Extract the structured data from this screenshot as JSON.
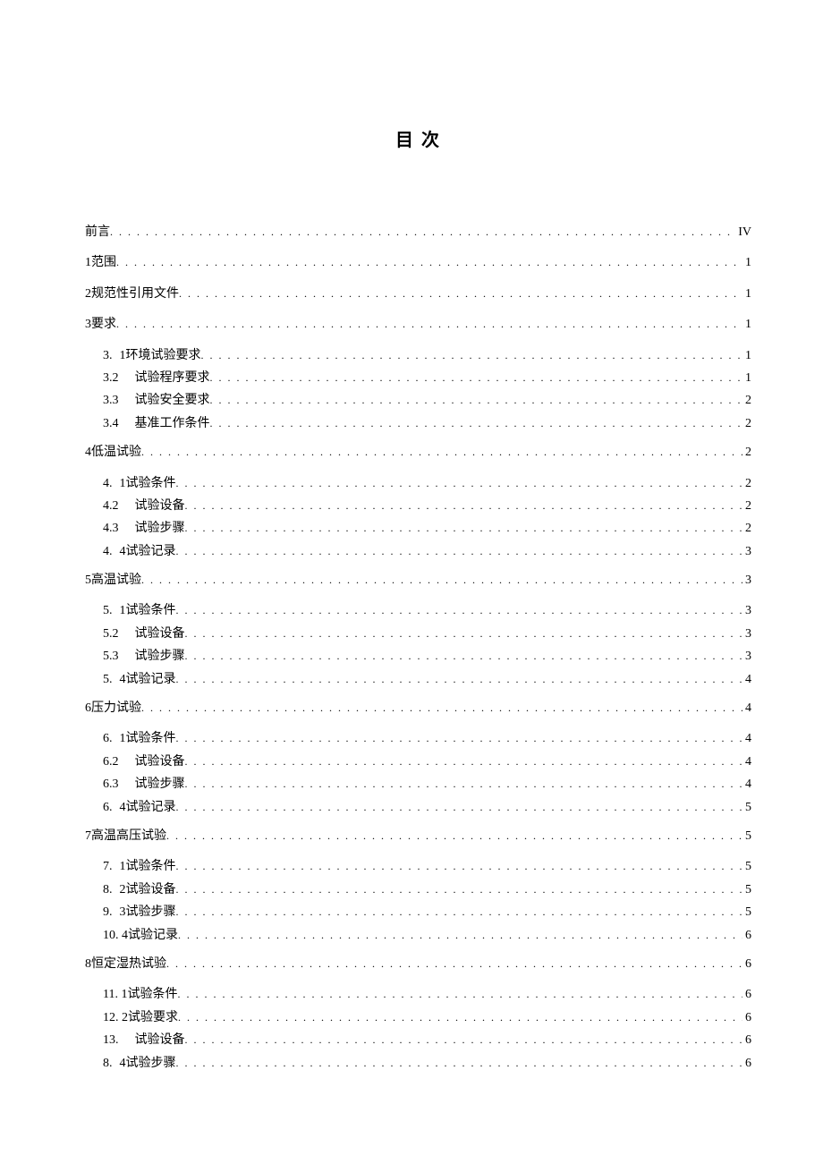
{
  "title": "目 次",
  "toc": [
    {
      "level": 1,
      "num": "",
      "label": "前言",
      "page": "IV"
    },
    {
      "level": 1,
      "num": "1",
      "label": "范围",
      "page": "1"
    },
    {
      "level": 1,
      "num": "2",
      "label": "规范性引用文件",
      "page": "1"
    },
    {
      "level": 1,
      "num": "3",
      "label": "要求",
      "page": "1",
      "children": [
        {
          "num": "3.",
          "sub": "1",
          "label": "环境试验要求",
          "page": "1",
          "style": "split"
        },
        {
          "num": "3.2",
          "label": "试验程序要求",
          "page": "1",
          "style": "wide"
        },
        {
          "num": "3.3",
          "label": "试验安全要求",
          "page": "2",
          "style": "wide"
        },
        {
          "num": "3.4",
          "label": "基准工作条件",
          "page": "2",
          "style": "wide"
        }
      ]
    },
    {
      "level": 1,
      "num": "4",
      "label": "低温试验",
      "page": "2",
      "children": [
        {
          "num": "4.",
          "sub": "1",
          "label": "试验条件",
          "page": "2",
          "style": "split"
        },
        {
          "num": "4.2",
          "label": "试验设备",
          "page": "2",
          "style": "wide"
        },
        {
          "num": "4.3",
          "label": "试验步骤",
          "page": "2",
          "style": "wide"
        },
        {
          "num": "4.",
          "sub": "4",
          "label": "试验记录",
          "page": "3",
          "style": "split"
        }
      ]
    },
    {
      "level": 1,
      "num": "5",
      "label": "高温试验",
      "page": "3",
      "children": [
        {
          "num": "5.",
          "sub": "1",
          "label": "试验条件",
          "page": "3",
          "style": "split"
        },
        {
          "num": "5.2",
          "label": "试验设备",
          "page": "3",
          "style": "wide"
        },
        {
          "num": "5.3",
          "label": "试验步骤",
          "page": "3",
          "style": "wide"
        },
        {
          "num": "5.",
          "sub": "4",
          "label": "试验记录",
          "page": "4",
          "style": "split"
        }
      ]
    },
    {
      "level": 1,
      "num": "6",
      "label": "压力试验",
      "page": "4",
      "children": [
        {
          "num": "6.",
          "sub": "1",
          "label": "试验条件",
          "page": "4",
          "style": "split"
        },
        {
          "num": "6.2",
          "label": "试验设备",
          "page": "4",
          "style": "wide"
        },
        {
          "num": "6.3",
          "label": "试验步骤",
          "page": "4",
          "style": "wide"
        },
        {
          "num": "6.",
          "sub": "4",
          "label": "试验记录",
          "page": "5",
          "style": "split"
        }
      ]
    },
    {
      "level": 1,
      "num": "7",
      "label": "高温高压试验",
      "page": "5",
      "children": [
        {
          "num": "7.",
          "sub": "1",
          "label": "试验条件",
          "page": "5",
          "style": "split"
        },
        {
          "num": "8.",
          "sub": "2",
          "label": "试验设备",
          "page": "5",
          "style": "split"
        },
        {
          "num": "9.",
          "sub": "3",
          "label": "试验步骤",
          "page": "5",
          "style": "split"
        },
        {
          "num": "10.",
          "sub": "4",
          "label": "试验记录",
          "page": "6",
          "style": "tight"
        }
      ]
    },
    {
      "level": 1,
      "num": "8",
      "label": "恒定湿热试验",
      "page": "6",
      "children": [
        {
          "num": "11.",
          "sub": "1",
          "label": "试验条件",
          "page": "6",
          "style": "tight"
        },
        {
          "num": "12.",
          "sub": "2",
          "label": "试验要求",
          "page": "6",
          "style": "tight"
        },
        {
          "num": "13.",
          "label": "试验设备",
          "page": "6",
          "style": "wide"
        },
        {
          "num": "8.",
          "sub": "4",
          "label": "试验步骤",
          "page": "6",
          "style": "split"
        }
      ]
    }
  ]
}
